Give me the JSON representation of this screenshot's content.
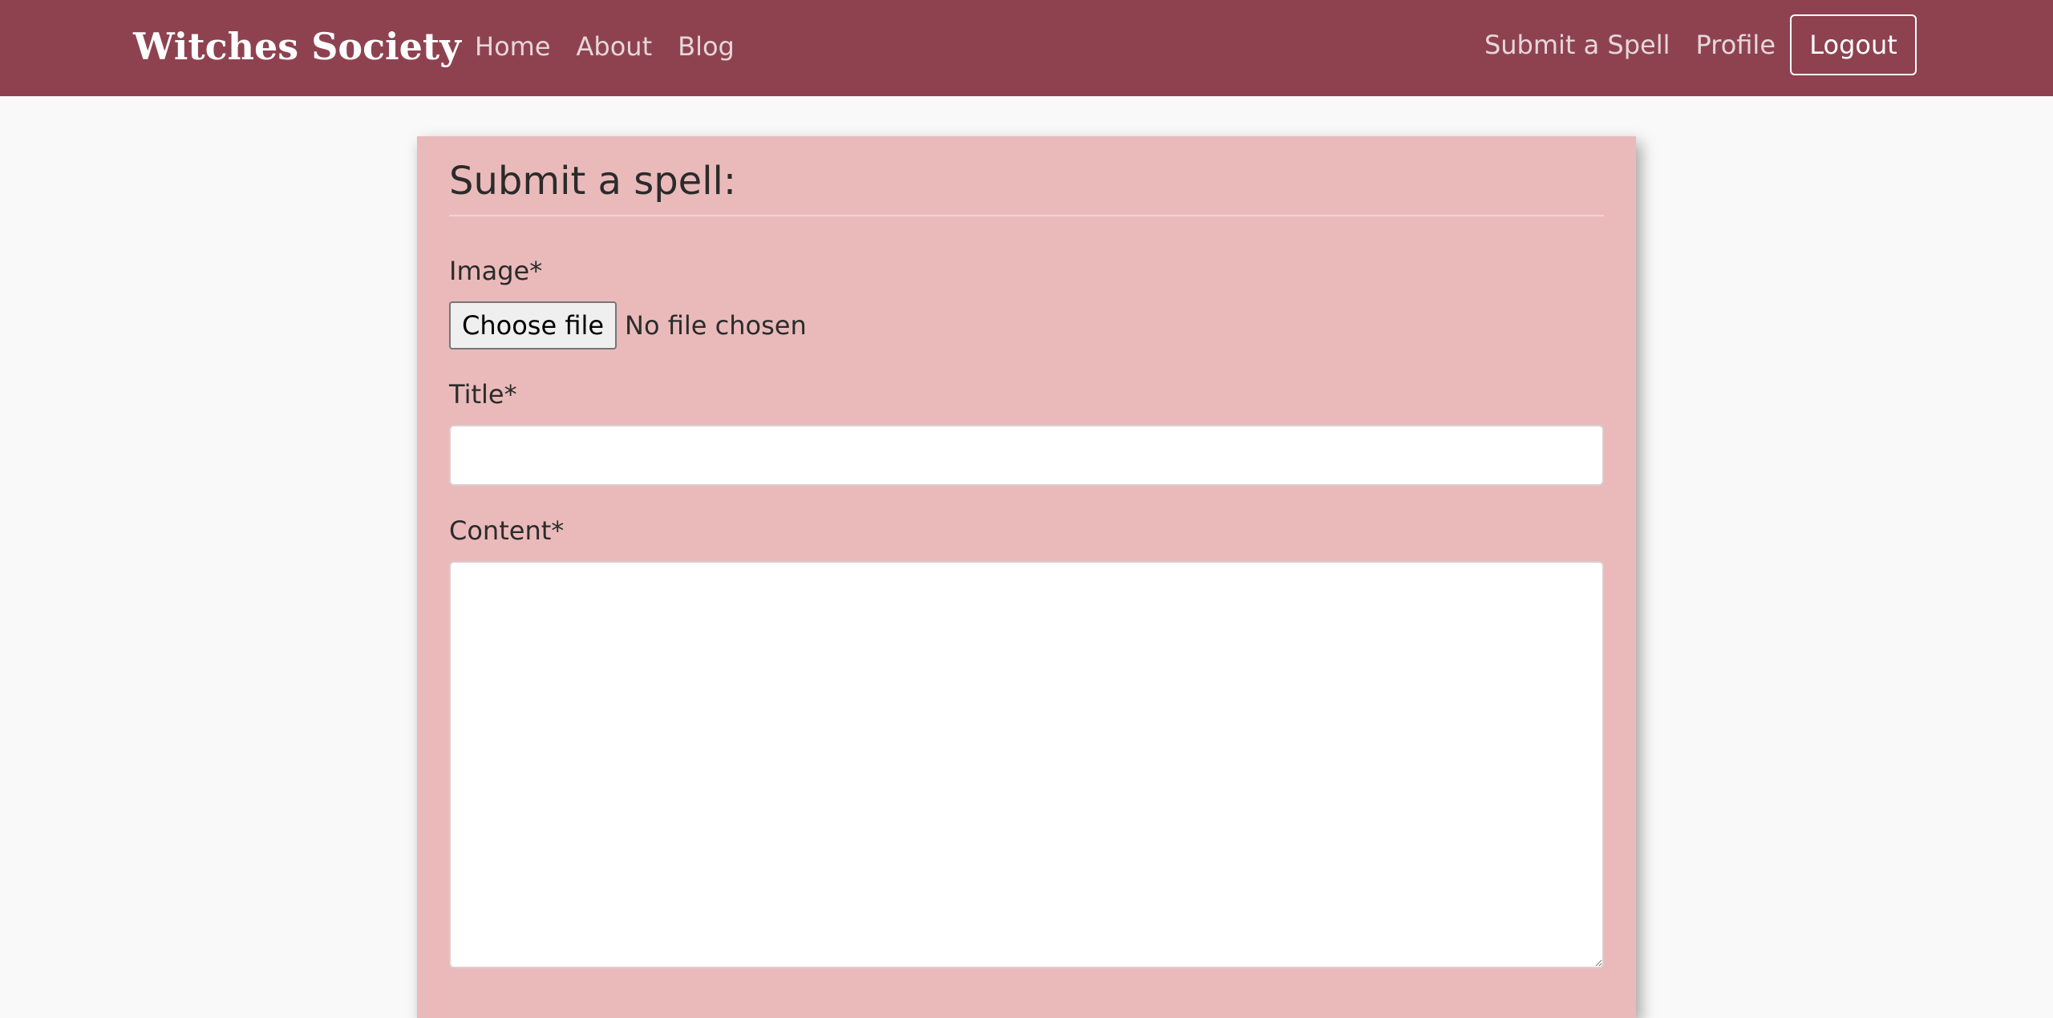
{
  "navbar": {
    "brand": "Witches Society",
    "left_links": [
      "Home",
      "About",
      "Blog"
    ],
    "right_links": [
      "Submit a Spell",
      "Profile"
    ],
    "logout_label": "Logout"
  },
  "form": {
    "heading": "Submit a spell:",
    "image_label": "Image*",
    "file_button_label": "Choose file",
    "file_status": "No file chosen",
    "title_label": "Title*",
    "title_value": "",
    "content_label": "Content*",
    "content_value": ""
  },
  "colors": {
    "navbar_bg": "#8e4250",
    "card_bg": "#eababb",
    "page_bg": "#f9f9f9"
  }
}
